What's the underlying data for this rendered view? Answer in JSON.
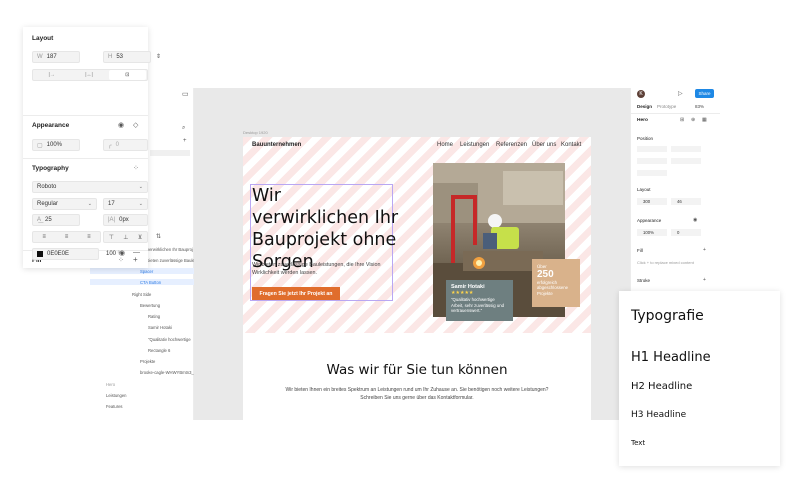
{
  "props_panel": {
    "layout": {
      "title": "Layout",
      "w_label": "W",
      "w_value": "187",
      "h_label": "H",
      "h_value": "53"
    },
    "appearance": {
      "title": "Appearance",
      "opacity": "100%",
      "radius": "0"
    },
    "typography": {
      "title": "Typography",
      "font": "Roboto",
      "weight": "Regular",
      "size": "17",
      "line_height": "25",
      "letter_spacing": "0px"
    },
    "fill": {
      "title": "Fill",
      "hex": "0E0E0E",
      "opacity": "100",
      "unit": "%"
    }
  },
  "left_sidebar": {
    "layers": [
      {
        "label": "verwirklichen Ihr Bauproj",
        "selected": false
      },
      {
        "label": "bieten zuverlässige Bauleis",
        "selected": false
      },
      {
        "label": "Spacer",
        "selected": true
      },
      {
        "label": "CTA Button",
        "selected": true
      },
      {
        "label": "Right Side",
        "selected": false
      },
      {
        "label": "Bewertung",
        "selected": false
      },
      {
        "label": "Rating",
        "selected": false
      },
      {
        "label": "Samir Hotaki",
        "selected": false
      },
      {
        "label": "\"Qualitativ hochwertige",
        "selected": false
      },
      {
        "label": "Rectangle 6",
        "selected": false
      },
      {
        "label": "Projekte",
        "selected": false
      },
      {
        "label": "brooke-cagle-WHWYBmtn3_",
        "selected": false
      },
      {
        "label": "Hero",
        "selected": false
      },
      {
        "label": "Leistungen",
        "selected": false
      },
      {
        "label": "Features",
        "selected": false
      }
    ]
  },
  "canvas": {
    "frame_label": "Desktop 1920",
    "brand": "Bauunternehmen",
    "nav": [
      "Home",
      "Leistungen",
      "Referenzen",
      "Über uns",
      "Kontakt"
    ],
    "hero_title": "Wir verwirklichen Ihr Bauprojekt ohne Sorgen",
    "hero_sub": "Wir bieten zuverlässige Bauleistungen, die Ihre Vision Wirklichkeit werden lassen.",
    "cta": "Fragen Sie jetzt Ihr Projekt an",
    "review": {
      "name": "Samir Hotaki",
      "stars": "★★★★★",
      "quote": "\"Qualitativ hochwertige Arbeit, sehr zuverlässig und vertrauenswert.\""
    },
    "stat": {
      "prefix": "Über",
      "number": "250",
      "caption": "erfolgreich abgeschlossene Projekte"
    },
    "services_title": "Was wir für Sie tun können",
    "services_sub": "Wir bieten Ihnen ein breites Spektrum an Leistungen rund um Ihr Zuhause an. Sie benötigen noch weitere Leistungen? Schreiben Sie uns gerne über das Kontaktformular."
  },
  "right_sidebar": {
    "avatar": "K",
    "share": "Share",
    "tabs": [
      "Design",
      "Prototype"
    ],
    "zoom": "83%",
    "frame_name": "Hero",
    "position_title": "Position",
    "layout_title": "Layout",
    "layout_w": "300",
    "layout_h": "46",
    "appearance_title": "Appearance",
    "appearance_opacity": "100%",
    "appearance_radius": "0",
    "fill_title": "Fill",
    "fill_hint": "Click + to replace mixed content",
    "stroke_title": "Stroke"
  },
  "typo_card": {
    "title": "Typografie",
    "h1": "H1 Headline",
    "h2": "H2 Headline",
    "h3": "H3 Headline",
    "text": "Text"
  },
  "colors": {
    "cta": "#e06d2c",
    "share_button": "#1e88e5",
    "review_card": "#6e7f80",
    "stat_card": "#d9b28b",
    "hero_stripe": "#fbe7e6",
    "selection": "#b9a7f3",
    "fill_swatch": "#0e0e0e"
  }
}
